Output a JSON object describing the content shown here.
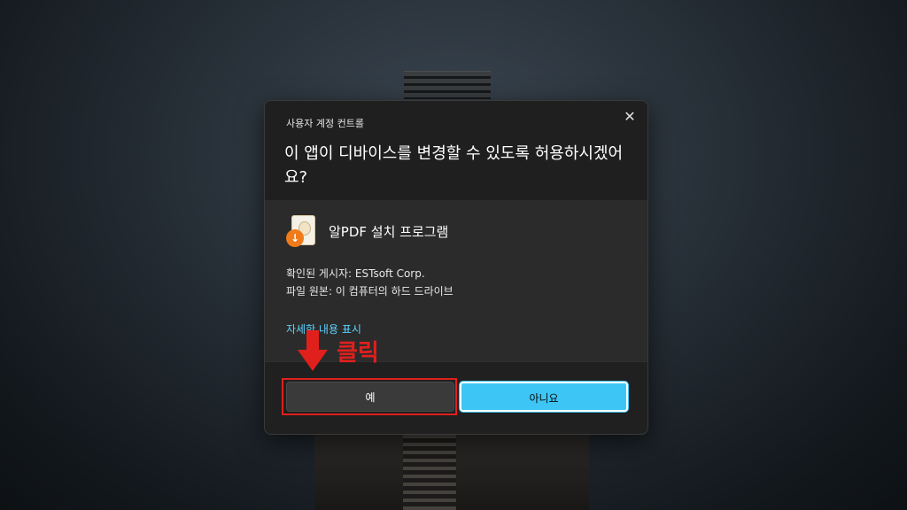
{
  "dialog": {
    "title": "사용자 계정 컨트롤",
    "close_symbol": "✕",
    "question": "이 앱이 디바이스를 변경할 수 있도록 허용하시겠어요?",
    "app_icon": "alpdf-installer-icon",
    "app_name": "알PDF 설치 프로그램",
    "publisher": "확인된 게시자: ESTsoft Corp.",
    "origin": "파일 원본: 이 컴퓨터의 하드 드라이브",
    "details_link": "자세한 내용 표시",
    "yes_label": "예",
    "no_label": "아니요"
  },
  "annotation": {
    "label": "클릭",
    "color": "#e0201d"
  },
  "colors": {
    "accent": "#3dc6f5",
    "link": "#5cd3ff",
    "dialog_bg": "#2b2b2b"
  }
}
